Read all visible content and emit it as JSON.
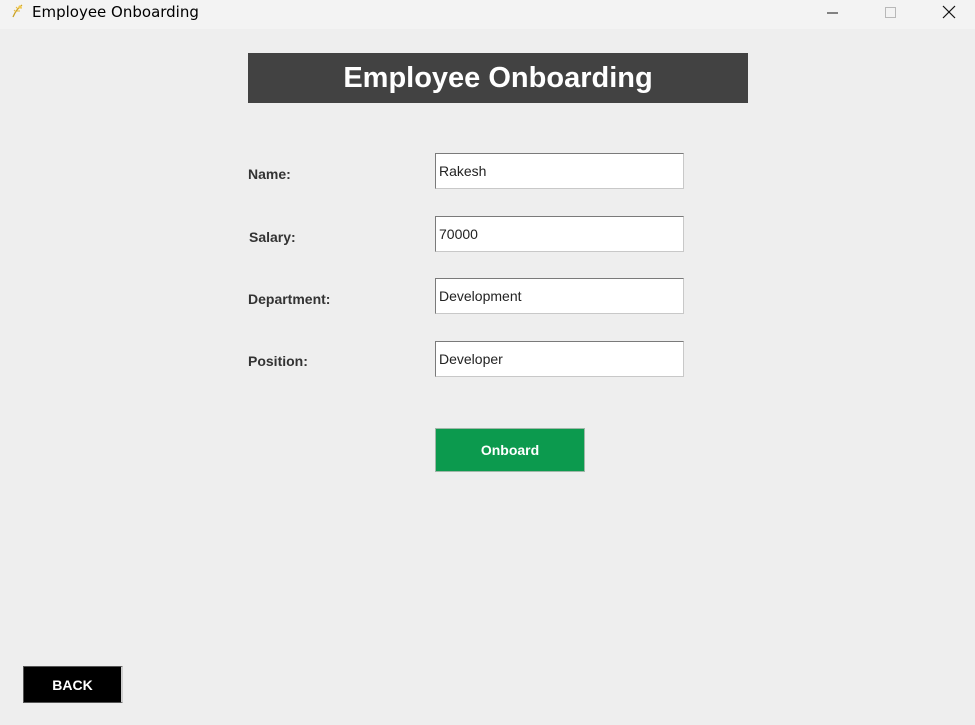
{
  "window": {
    "title": "Employee Onboarding",
    "app_icon": "feather-icon",
    "controls": [
      "minimize-icon",
      "maximize-icon",
      "close-icon"
    ]
  },
  "header": {
    "title": "Employee Onboarding",
    "background": "#424242"
  },
  "form": {
    "name_label": "Name:",
    "name_value": "Rakesh",
    "salary_label": "Salary:",
    "salary_value": "70000",
    "department_label": "Department:",
    "department_value": "Development",
    "position_label": "Position:",
    "position_value": "Developer"
  },
  "actions": {
    "onboard_label": "Onboard",
    "onboard_color": "#0c9a4e",
    "back_label": "BACK",
    "back_color": "#000000"
  }
}
